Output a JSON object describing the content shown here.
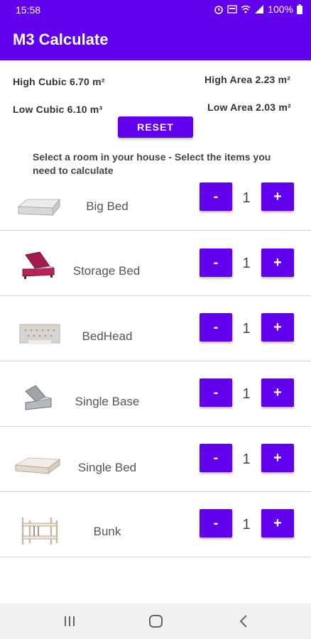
{
  "status_bar": {
    "time": "15:58",
    "battery": "100%"
  },
  "app_bar": {
    "title": "M3 Calculate"
  },
  "stats": {
    "high_cubic": "High Cubic 6.70 m²",
    "high_area": "High Area 2.23 m²",
    "low_cubic": "Low Cubic 6.10 m³",
    "low_area": "Low Area 2.03 m²"
  },
  "reset_label": "RESET",
  "instructions": "Select a room in your house - Select the items you need to calculate",
  "items": [
    {
      "name": "Big Bed",
      "qty": "1",
      "minus": "-",
      "plus": "+",
      "icon": "mattress-image"
    },
    {
      "name": "Storage Bed",
      "qty": "1",
      "minus": "-",
      "plus": "+",
      "icon": "storage-bed-image"
    },
    {
      "name": "BedHead",
      "qty": "1",
      "minus": "-",
      "plus": "+",
      "icon": "bedhead-image"
    },
    {
      "name": "Single Base",
      "qty": "1",
      "minus": "-",
      "plus": "+",
      "icon": "single-base-image"
    },
    {
      "name": "Single Bed",
      "qty": "1",
      "minus": "-",
      "plus": "+",
      "icon": "single-mattress-image"
    },
    {
      "name": "Bunk",
      "qty": "1",
      "minus": "-",
      "plus": "+",
      "icon": "bunk-bed-image"
    }
  ],
  "colors": {
    "primary": "#6200ee",
    "divider": "#d4d4d4",
    "nav_bg": "#f1f1f1"
  }
}
